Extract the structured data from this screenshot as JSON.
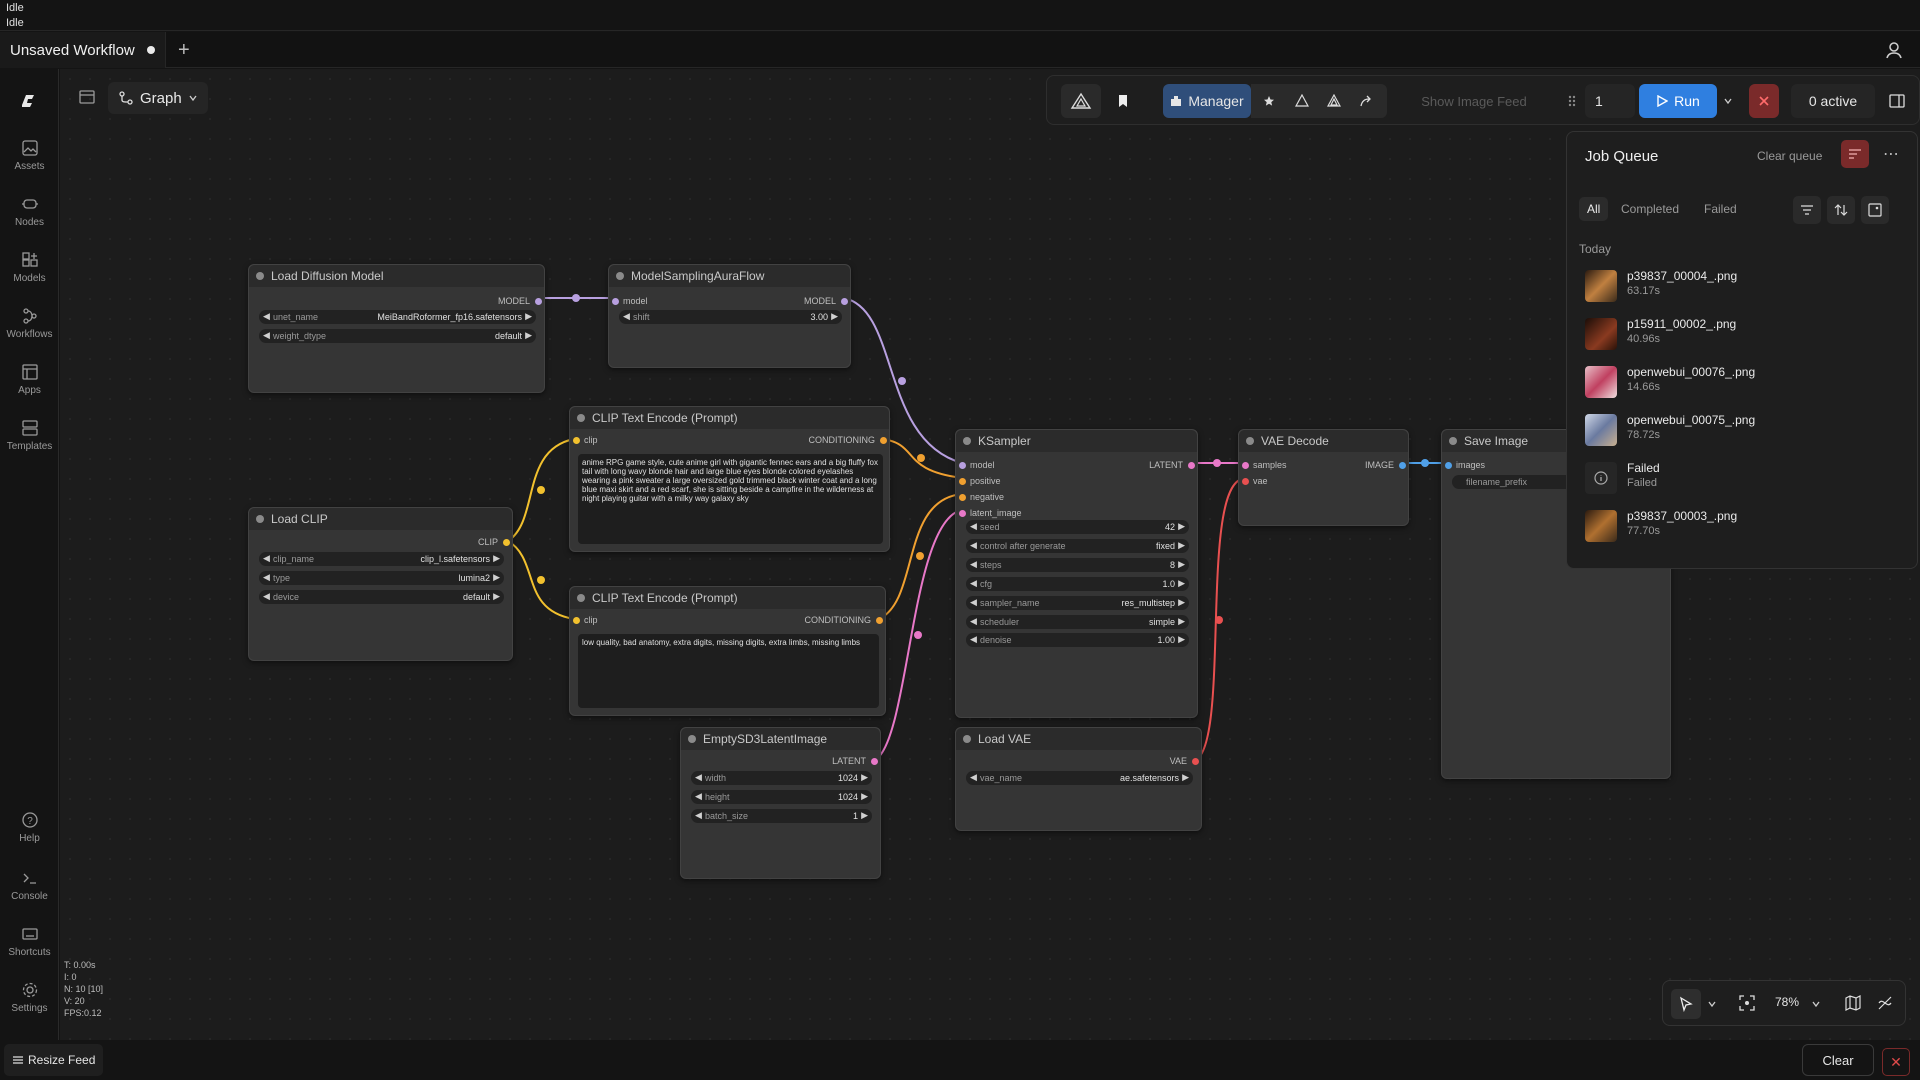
{
  "status": {
    "line1": "Idle",
    "line2": "Idle"
  },
  "tabs": [
    {
      "label": "Unsaved Workflow"
    }
  ],
  "tab_add": "+",
  "sidebar": {
    "items": [
      {
        "label": "Assets",
        "icon": "image-icon"
      },
      {
        "label": "Nodes",
        "icon": "node-icon"
      },
      {
        "label": "Models",
        "icon": "models-icon"
      },
      {
        "label": "Workflows",
        "icon": "workflows-icon"
      },
      {
        "label": "Apps",
        "icon": "apps-icon"
      },
      {
        "label": "Templates",
        "icon": "templates-icon"
      }
    ],
    "bottom": [
      {
        "label": "Help",
        "icon": "help-icon"
      },
      {
        "label": "Console",
        "icon": "console-icon"
      },
      {
        "label": "Shortcuts",
        "icon": "keyboard-icon"
      },
      {
        "label": "Settings",
        "icon": "gear-icon"
      }
    ]
  },
  "perf": {
    "t": "T: 0.00s",
    "i": "I: 0",
    "n": "N: 10 [10]",
    "v": "V: 20",
    "fps": "FPS:0.12"
  },
  "graph_mode": "Graph",
  "toolbar": {
    "manager": "Manager",
    "show_image_feed": "Show Image Feed",
    "batch_count": "1",
    "run": "Run",
    "active": "0 active"
  },
  "job_queue": {
    "title": "Job Queue",
    "clear_label": "Clear queue",
    "tabs": [
      "All",
      "Completed",
      "Failed"
    ],
    "section": "Today",
    "items": [
      {
        "name": "p39837_00004_.png",
        "time": "63.17s"
      },
      {
        "name": "p15911_00002_.png",
        "time": "40.96s"
      },
      {
        "name": "openwebui_00076_.png",
        "time": "14.66s"
      },
      {
        "name": "openwebui_00075_.png",
        "time": "78.72s"
      },
      {
        "name": "Failed",
        "time": "Failed"
      },
      {
        "name": "p39837_00003_.png",
        "time": "77.70s"
      }
    ]
  },
  "nodes": {
    "load_diffusion": {
      "title": "Load Diffusion Model",
      "out": "MODEL",
      "w1l": "unet_name",
      "w1v": "MeiBandRoformer_fp16.safetensors",
      "w2l": "weight_dtype",
      "w2v": "default"
    },
    "msaf": {
      "title": "ModelSamplingAuraFlow",
      "in": "model",
      "out": "MODEL",
      "w1l": "shift",
      "w1v": "3.00"
    },
    "clip_pos": {
      "title": "CLIP Text Encode (Prompt)",
      "in": "clip",
      "out": "CONDITIONING",
      "text": "anime RPG game style, cute anime girl with gigantic fennec ears and a big fluffy fox tail with long wavy blonde hair and large blue eyes blonde colored eyelashes wearing a pink sweater a large oversized gold trimmed black winter coat and a long blue maxi skirt and a red scarf, she is sitting beside a campfire in the wilderness at night playing guitar with a milky way galaxy sky"
    },
    "clip_neg": {
      "title": "CLIP Text Encode (Prompt)",
      "in": "clip",
      "out": "CONDITIONING",
      "text": "low quality, bad anatomy, extra digits, missing digits, extra limbs, missing limbs"
    },
    "load_clip": {
      "title": "Load CLIP",
      "out": "CLIP",
      "w1l": "clip_name",
      "w1v": "clip_l.safetensors",
      "w2l": "type",
      "w2v": "lumina2",
      "w3l": "device",
      "w3v": "default"
    },
    "ksampler": {
      "title": "KSampler",
      "in1": "model",
      "in2": "positive",
      "in3": "negative",
      "in4": "latent_image",
      "out": "LATENT",
      "widgets": [
        {
          "l": "seed",
          "v": "42"
        },
        {
          "l": "control after generate",
          "v": "fixed"
        },
        {
          "l": "steps",
          "v": "8"
        },
        {
          "l": "cfg",
          "v": "1.0"
        },
        {
          "l": "sampler_name",
          "v": "res_multistep"
        },
        {
          "l": "scheduler",
          "v": "simple"
        },
        {
          "l": "denoise",
          "v": "1.00"
        }
      ]
    },
    "vae_decode": {
      "title": "VAE Decode",
      "in1": "samples",
      "in2": "vae",
      "out": "IMAGE"
    },
    "save_image": {
      "title": "Save Image",
      "in": "images",
      "w1": "filename_prefix"
    },
    "empty_latent": {
      "title": "EmptySD3LatentImage",
      "out": "LATENT",
      "w1l": "width",
      "w1v": "1024",
      "w2l": "height",
      "w2v": "1024",
      "w3l": "batch_size",
      "w3v": "1"
    },
    "load_vae": {
      "title": "Load VAE",
      "out": "VAE",
      "w1l": "vae_name",
      "w1v": "ae.safetensors"
    }
  },
  "zoom": "78%",
  "bottom": {
    "resize_feed": "Resize Feed",
    "clear": "Clear"
  }
}
